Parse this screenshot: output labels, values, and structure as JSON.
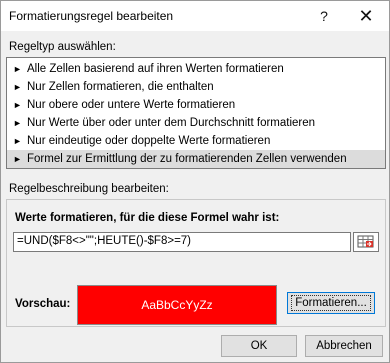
{
  "window": {
    "title": "Formatierungsregel bearbeiten",
    "help_label": "?",
    "close_label": "✕"
  },
  "rule_type": {
    "heading": "Regeltyp auswählen:",
    "items": [
      {
        "label": "Alle Zellen basierend auf ihren Werten formatieren"
      },
      {
        "label": "Nur Zellen formatieren, die enthalten"
      },
      {
        "label": "Nur obere oder untere Werte formatieren"
      },
      {
        "label": "Nur Werte über oder unter dem Durchschnitt formatieren"
      },
      {
        "label": "Nur eindeutige oder doppelte Werte formatieren"
      },
      {
        "label": "Formel zur Ermittlung der zu formatierenden Zellen verwenden",
        "selected": true
      }
    ],
    "bullet": "►"
  },
  "description": {
    "heading": "Regelbeschreibung bearbeiten:",
    "formula_title": "Werte formatieren, für die diese Formel wahr ist:",
    "formula_value": "=UND($F8<>\"\";HEUTE()-$F8>=7)",
    "preview_label": "Vorschau:",
    "preview_text": "AaBbCcYyZz",
    "preview_fill": "#ff0000",
    "format_button": "Formatieren..."
  },
  "footer": {
    "ok_label": "OK",
    "cancel_label": "Abbrechen"
  }
}
